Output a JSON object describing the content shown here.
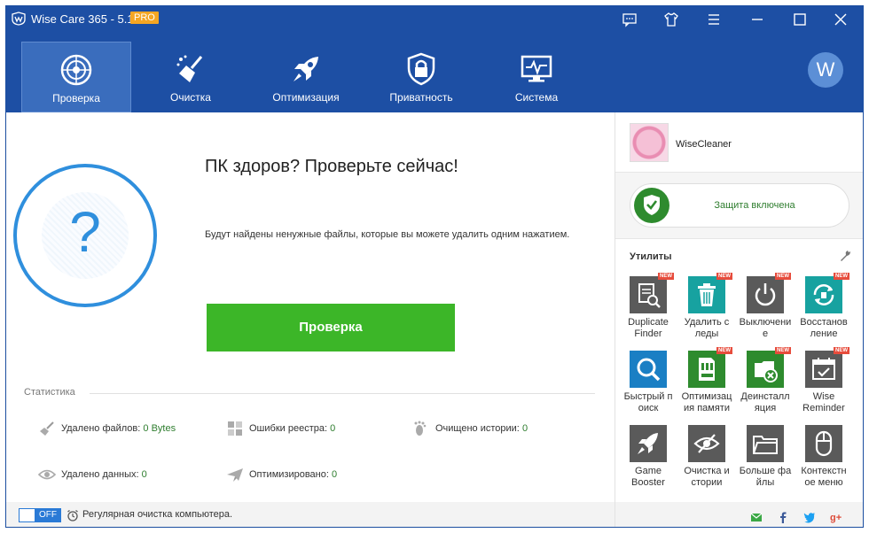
{
  "window": {
    "title": "Wise Care 365 - 5.1.9",
    "badge": "PRO",
    "controls": [
      "feedback-icon",
      "skin-icon",
      "menu-icon",
      "minimize-icon",
      "maximize-icon",
      "close-icon"
    ]
  },
  "nav": {
    "items": [
      {
        "label": "Проверка",
        "icon": "radar-icon",
        "active": true
      },
      {
        "label": "Очистка",
        "icon": "broom-icon",
        "active": false
      },
      {
        "label": "Оптимизация",
        "icon": "rocket-icon",
        "active": false
      },
      {
        "label": "Приватность",
        "icon": "lock-icon",
        "active": false
      },
      {
        "label": "Система",
        "icon": "monitor-icon",
        "active": false
      }
    ],
    "avatar_letter": "W"
  },
  "main": {
    "headline": "ПК здоров? Проверьте сейчас!",
    "description": "Будут найдены ненужные файлы, которые вы можете удалить одним нажатием.",
    "scan_button": "Проверка",
    "status_symbol": "?",
    "stats_title": "Статистика",
    "stats": [
      {
        "label": "Удалено файлов:",
        "value": "0 Bytes"
      },
      {
        "label": "Ошибки реестра:",
        "value": "0"
      },
      {
        "label": "Очищено истории:",
        "value": "0"
      },
      {
        "label": "Удалено данных:",
        "value": "0"
      },
      {
        "label": "Оптимизировано:",
        "value": "0"
      }
    ]
  },
  "footer": {
    "toggle_state": "OFF",
    "text": "Регулярная очистка компьютера."
  },
  "right": {
    "profile_name": "WiseCleaner",
    "protection": "Защита включена",
    "utilities_title": "Утилиты",
    "new_badge": "NEW",
    "tools": [
      {
        "label": "Duplicate\nFinder",
        "color": "#5a5a5a"
      },
      {
        "label": "Удалить с\nледы",
        "color": "#17a2a0"
      },
      {
        "label": "Выключени\nе",
        "color": "#5a5a5a"
      },
      {
        "label": "Восстанов\nление",
        "color": "#17a2a0"
      },
      {
        "label": "Быстрый п\nоиск",
        "color": "#1a7fc4"
      },
      {
        "label": "Оптимизац\nия памяти",
        "color": "#2e8b2e"
      },
      {
        "label": "Деинсталл\nяция",
        "color": "#2e8b2e"
      },
      {
        "label": "Wise\nReminder",
        "color": "#5a5a5a"
      },
      {
        "label": "Game\nBooster",
        "color": "#5a5a5a"
      },
      {
        "label": "Очистка и\nстории",
        "color": "#5a5a5a"
      },
      {
        "label": "Больше фа\nйлы",
        "color": "#5a5a5a"
      },
      {
        "label": "Контекстн\nое меню",
        "color": "#5a5a5a"
      }
    ],
    "social": [
      "mail-icon",
      "facebook-icon",
      "twitter-icon",
      "google-plus-icon"
    ]
  }
}
